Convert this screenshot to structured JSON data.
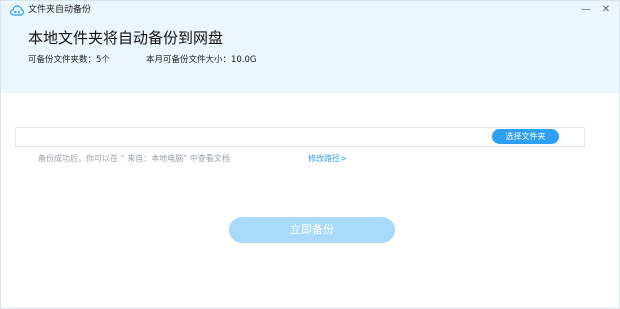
{
  "window": {
    "title": "文件夹自动备份",
    "icon": "cloud-icon",
    "minimize_glyph": "—",
    "close_glyph": "✕"
  },
  "header": {
    "title": "本地文件夹将自动备份到网盘",
    "stat_count": "可备份文件夹数：5个",
    "stat_size": "本月可备份文件大小：10.0G"
  },
  "folder": {
    "path_value": "",
    "choose_label": "选择文件夹"
  },
  "hint": {
    "text": "备份成功后，你可以在 “ 来自：本地电脑” 中查看文档",
    "link_label": "修改路径>"
  },
  "actions": {
    "backup_label": "立即备份"
  },
  "colors": {
    "header_bg": "#eaf5fd",
    "accent": "#2d9ff5",
    "disabled_button": "#a9d9fb"
  }
}
